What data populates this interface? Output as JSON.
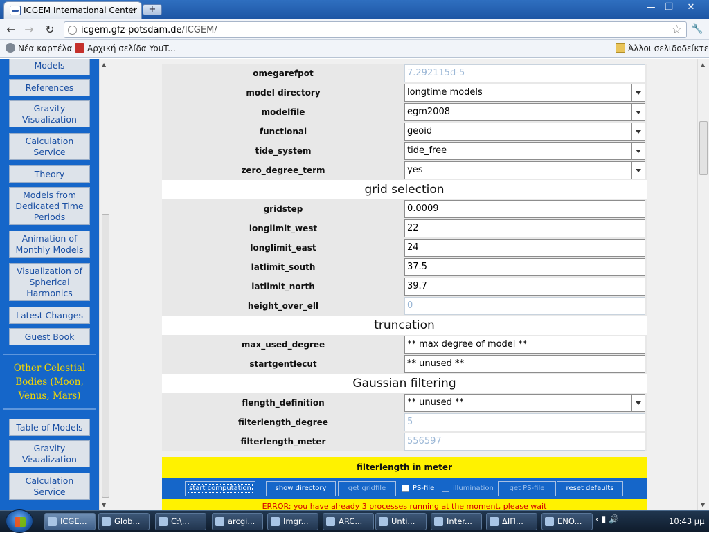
{
  "browser": {
    "tab_title": "ICGEM International Center",
    "tab_close": "×",
    "new_tab": "+",
    "url_host": "icgem.gfz-potsdam.de",
    "url_path": "/ICGEM/",
    "bookmarks": [
      {
        "label": "Νέα καρτέλα",
        "icon": "globe-icon"
      },
      {
        "label": "Αρχική σελίδα YouT...",
        "icon": "youtube-icon"
      }
    ],
    "other_bookmarks": "Άλλοι σελιδοδείκτες",
    "win_buttons": {
      "minimize": "—",
      "maximize": "❐",
      "close": "✕"
    }
  },
  "sidebar": {
    "items_top": [
      {
        "label": "Models"
      },
      {
        "label": "References"
      },
      {
        "label": "Gravity Visualization"
      },
      {
        "label": "Calculation Service"
      },
      {
        "label": "Theory"
      },
      {
        "label": "Models from Dedicated Time Periods"
      },
      {
        "label": "Animation of Monthly Models"
      },
      {
        "label": "Visualization of Spherical Harmonics"
      },
      {
        "label": "Latest Changes"
      },
      {
        "label": "Guest Book"
      }
    ],
    "celestial_heading": "Other Celestial Bodies (Moon, Venus, Mars)",
    "items_bottom": [
      {
        "label": "Table of Models"
      },
      {
        "label": "Gravity Visualization"
      },
      {
        "label": "Calculation Service"
      }
    ]
  },
  "form": {
    "rows_top": [
      {
        "label": "omegarefpot",
        "value": "7.292115d-5",
        "kind": "disabled"
      },
      {
        "label": "model directory",
        "value": "longtime models",
        "kind": "select"
      },
      {
        "label": "modelfile",
        "value": "egm2008",
        "kind": "select"
      },
      {
        "label": "functional",
        "value": "geoid",
        "kind": "select"
      },
      {
        "label": "tide_system",
        "value": "tide_free",
        "kind": "select"
      },
      {
        "label": "zero_degree_term",
        "value": "yes",
        "kind": "select"
      }
    ],
    "grid_section": "grid selection",
    "grid_rows": [
      {
        "label": "gridstep",
        "value": "0.0009",
        "kind": "text"
      },
      {
        "label": "longlimit_west",
        "value": "22",
        "kind": "text"
      },
      {
        "label": "longlimit_east",
        "value": "24",
        "kind": "text"
      },
      {
        "label": "latlimit_south",
        "value": "37.5",
        "kind": "text"
      },
      {
        "label": "latlimit_north",
        "value": "39.7",
        "kind": "text"
      },
      {
        "label": "height_over_ell",
        "value": "0",
        "kind": "disabled"
      }
    ],
    "truncation_section": "truncation",
    "truncation_rows": [
      {
        "label": "max_used_degree",
        "value": "** max degree of model **",
        "kind": "text"
      },
      {
        "label": "startgentlecut",
        "value": "** unused **",
        "kind": "text"
      }
    ],
    "gaussian_section": "Gaussian filtering",
    "gaussian_rows": [
      {
        "label": "flength_definition",
        "value": "** unused **",
        "kind": "select"
      },
      {
        "label": "filterlength_degree",
        "value": "5",
        "kind": "disabled"
      },
      {
        "label": "filterlength_meter",
        "value": "556597",
        "kind": "disabled"
      }
    ],
    "yellow_label": "filterlength in meter",
    "buttons": {
      "start": "start computation",
      "show_dir": "show directory",
      "get_grid": "get gridfile",
      "ps_file": "PS-file",
      "illumination": "illumination",
      "get_ps": "get PS-file",
      "reset": "reset defaults"
    },
    "error_text": "ERROR: you have already 3 processes running at the moment, please wait"
  },
  "taskbar": {
    "items": [
      {
        "label": "ICGE...",
        "active": true
      },
      {
        "label": "Glob..."
      },
      {
        "label": "C:\\..."
      },
      {
        "label": "arcgi..."
      },
      {
        "label": "Imgr..."
      },
      {
        "label": "ARC..."
      },
      {
        "label": "Unti..."
      },
      {
        "label": "Inter..."
      },
      {
        "label": "ΔΙΠ..."
      },
      {
        "label": "ENO..."
      }
    ],
    "clock": "10:43 μμ"
  }
}
